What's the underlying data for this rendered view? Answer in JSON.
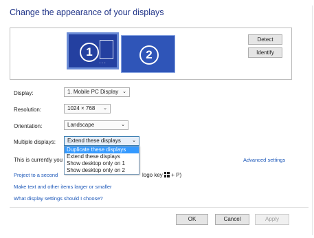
{
  "title": "Change the appearance of your displays",
  "monitors": [
    {
      "number": "1",
      "selected": true
    },
    {
      "number": "2",
      "selected": false
    }
  ],
  "monitor_buttons": {
    "detect": "Detect",
    "identify": "Identify"
  },
  "fields": {
    "display": {
      "label": "Display:",
      "value": "1. Mobile PC Display"
    },
    "resolution": {
      "label": "Resolution:",
      "value": "1024 × 768"
    },
    "orientation": {
      "label": "Orientation:",
      "value": "Landscape"
    },
    "multiple_displays": {
      "label": "Multiple displays:",
      "value": "Extend these displays"
    }
  },
  "dropdown_options": [
    "Duplicate these displays",
    "Extend these displays",
    "Show desktop only on 1",
    "Show desktop only on 2"
  ],
  "status_text": "This is currently you",
  "advanced_settings": "Advanced settings",
  "project_link": "Project to a second",
  "project_hint": "logo key",
  "project_keys": "+ P)",
  "links": {
    "text_size": "Make text and other items larger or smaller",
    "which_settings": "What display settings should I choose?"
  },
  "footer_buttons": {
    "ok": "OK",
    "cancel": "Cancel",
    "apply": "Apply"
  },
  "colors": {
    "accent_blue": "#2440a0",
    "link": "#1a56b8",
    "highlight": "#3399ff"
  },
  "icons": {
    "dropdown_arrow": "chevron-down-icon",
    "windows_key": "windows-logo-icon"
  }
}
